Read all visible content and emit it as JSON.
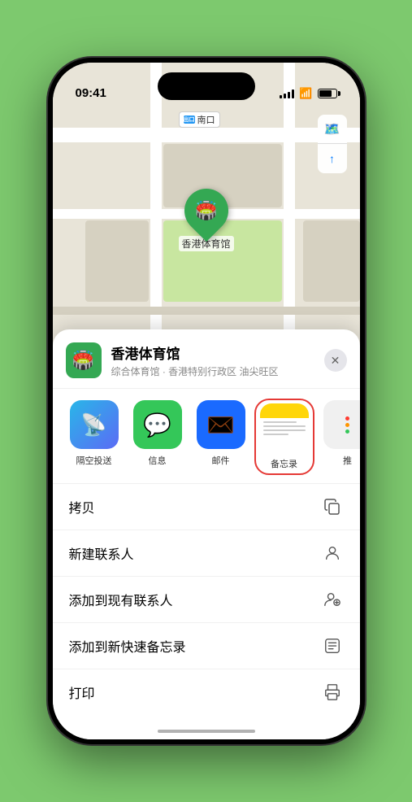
{
  "status_bar": {
    "time": "09:41",
    "location_arrow": "▶"
  },
  "map": {
    "label_text": "南口",
    "label_prefix": "出口",
    "pin_label": "香港体育馆",
    "pin_emoji": "🏟️"
  },
  "map_controls": {
    "map_btn": "🗺️",
    "location_btn": "⬆"
  },
  "venue": {
    "name": "香港体育馆",
    "subtitle": "综合体育馆 · 香港特别行政区 油尖旺区",
    "icon_emoji": "🏟️"
  },
  "close_btn_label": "✕",
  "share_apps": [
    {
      "id": "airdrop",
      "label": "隔空投送",
      "emoji": "📡"
    },
    {
      "id": "messages",
      "label": "信息",
      "emoji": "💬"
    },
    {
      "id": "mail",
      "label": "邮件",
      "emoji": "✉️"
    },
    {
      "id": "notes",
      "label": "备忘录",
      "emoji": ""
    },
    {
      "id": "more",
      "label": "推",
      "emoji": ""
    }
  ],
  "actions": [
    {
      "label": "拷贝",
      "icon": "copy"
    },
    {
      "label": "新建联系人",
      "icon": "person"
    },
    {
      "label": "添加到现有联系人",
      "icon": "person-add"
    },
    {
      "label": "添加到新快速备忘录",
      "icon": "note"
    },
    {
      "label": "打印",
      "icon": "print"
    }
  ],
  "more_dots_colors": [
    "#ff3b30",
    "#ff9500",
    "#34c759"
  ]
}
